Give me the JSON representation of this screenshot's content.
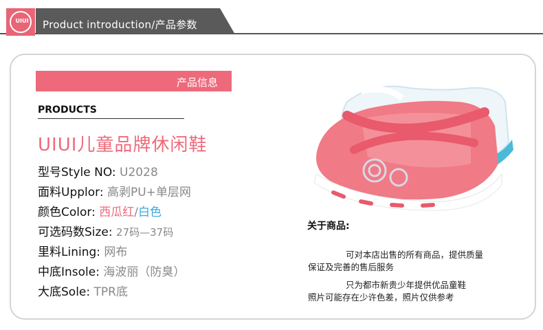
{
  "header": {
    "logo_text": "UIUI",
    "title": "Product introduction/产品参数"
  },
  "info": {
    "band_label": "产品信息",
    "section_label": "PRODUCTS",
    "product_name": "UIUI儿童品牌休闲鞋",
    "specs": [
      {
        "label": "型号Style NO:",
        "value": "U2028"
      },
      {
        "label": "面料Upplor:",
        "value": "高剥PU+单层网"
      },
      {
        "label": "颜色Color:",
        "value_red": "西瓜红",
        "separator": "/",
        "value_blue": "白色"
      },
      {
        "label": "可选码数Size:",
        "value": "27码—37码"
      },
      {
        "label": "里料Lining:",
        "value": "网布"
      },
      {
        "label": "中底Insole:",
        "value": "海波丽（防臭）"
      },
      {
        "label": "大底Sole:",
        "value": "TPR底"
      }
    ]
  },
  "about": {
    "title": "关于商品:",
    "lines": [
      "可对本店出售的所有商品，提供质量",
      "保证及完善的售后服务",
      "只为都市新贵少年提供优品童鞋",
      "照片可能存在少许色差，照片仅供参考"
    ]
  },
  "colors": {
    "accent_pink": "#ee6a7b",
    "accent_blue": "#3aa8e0",
    "header_dark": "#5a5a5a"
  },
  "image": {
    "subject": "pink-and-blue-children-shoe"
  }
}
